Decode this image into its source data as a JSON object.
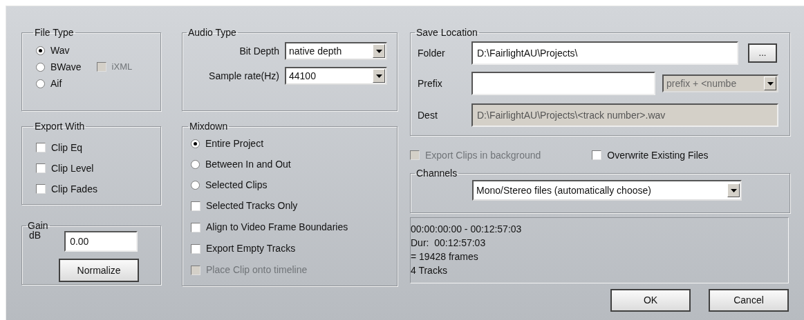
{
  "file_type": {
    "title": "File Type",
    "options": [
      {
        "label": "Wav",
        "selected": true
      },
      {
        "label": "BWave",
        "selected": false
      },
      {
        "label": "Aif",
        "selected": false
      }
    ],
    "ixml": {
      "label": "iXML",
      "checked": false,
      "disabled": true
    }
  },
  "export_with": {
    "title": "Export With",
    "options": [
      {
        "label": "Clip Eq",
        "checked": false
      },
      {
        "label": "Clip Level",
        "checked": false
      },
      {
        "label": "Clip Fades",
        "checked": false
      }
    ]
  },
  "gain": {
    "title": "Gain",
    "unit": "dB",
    "value": "0.00",
    "button": "Normalize"
  },
  "audio_type": {
    "title": "Audio Type",
    "fields": [
      {
        "label": "Bit Depth",
        "value": "native depth"
      },
      {
        "label": "Sample rate(Hz)",
        "value": "44100"
      }
    ]
  },
  "mixdown": {
    "title": "Mixdown",
    "radios": [
      {
        "label": "Entire Project",
        "selected": true
      },
      {
        "label": "Between In and Out",
        "selected": false
      },
      {
        "label": "Selected Clips",
        "selected": false
      }
    ],
    "checkboxes": [
      {
        "label": "Selected Tracks Only",
        "checked": false,
        "disabled": false
      },
      {
        "label": "Align to Video Frame Boundaries",
        "checked": false,
        "disabled": false
      },
      {
        "label": "Export Empty Tracks",
        "checked": false,
        "disabled": false
      },
      {
        "label": "Place Clip onto timeline",
        "checked": false,
        "disabled": true
      }
    ]
  },
  "save_location": {
    "title": "Save Location",
    "folder": {
      "label": "Folder",
      "value": "D:\\FairlightAU\\Projects\\",
      "button": "..."
    },
    "prefix": {
      "label": "Prefix",
      "mode": "prefix + <numbe",
      "mode_disabled": true
    },
    "dest": {
      "label": "Dest",
      "value": "D:\\FairlightAU\\Projects\\<track number>.wav",
      "disabled": true
    }
  },
  "options": [
    {
      "label": "Export Clips in background",
      "checked": false,
      "disabled": true
    },
    {
      "label": "Overwrite Existing Files",
      "checked": false,
      "disabled": false
    }
  ],
  "channels": {
    "title": "Channels",
    "value": "Mono/Stereo files (automatically choose)"
  },
  "summary": [
    "00:00:00:00 - 00:12:57:03",
    "Dur:  00:12:57:03",
    "= 19428 frames",
    "4 Tracks"
  ],
  "buttons": [
    {
      "label": "OK"
    },
    {
      "label": "Cancel"
    }
  ]
}
